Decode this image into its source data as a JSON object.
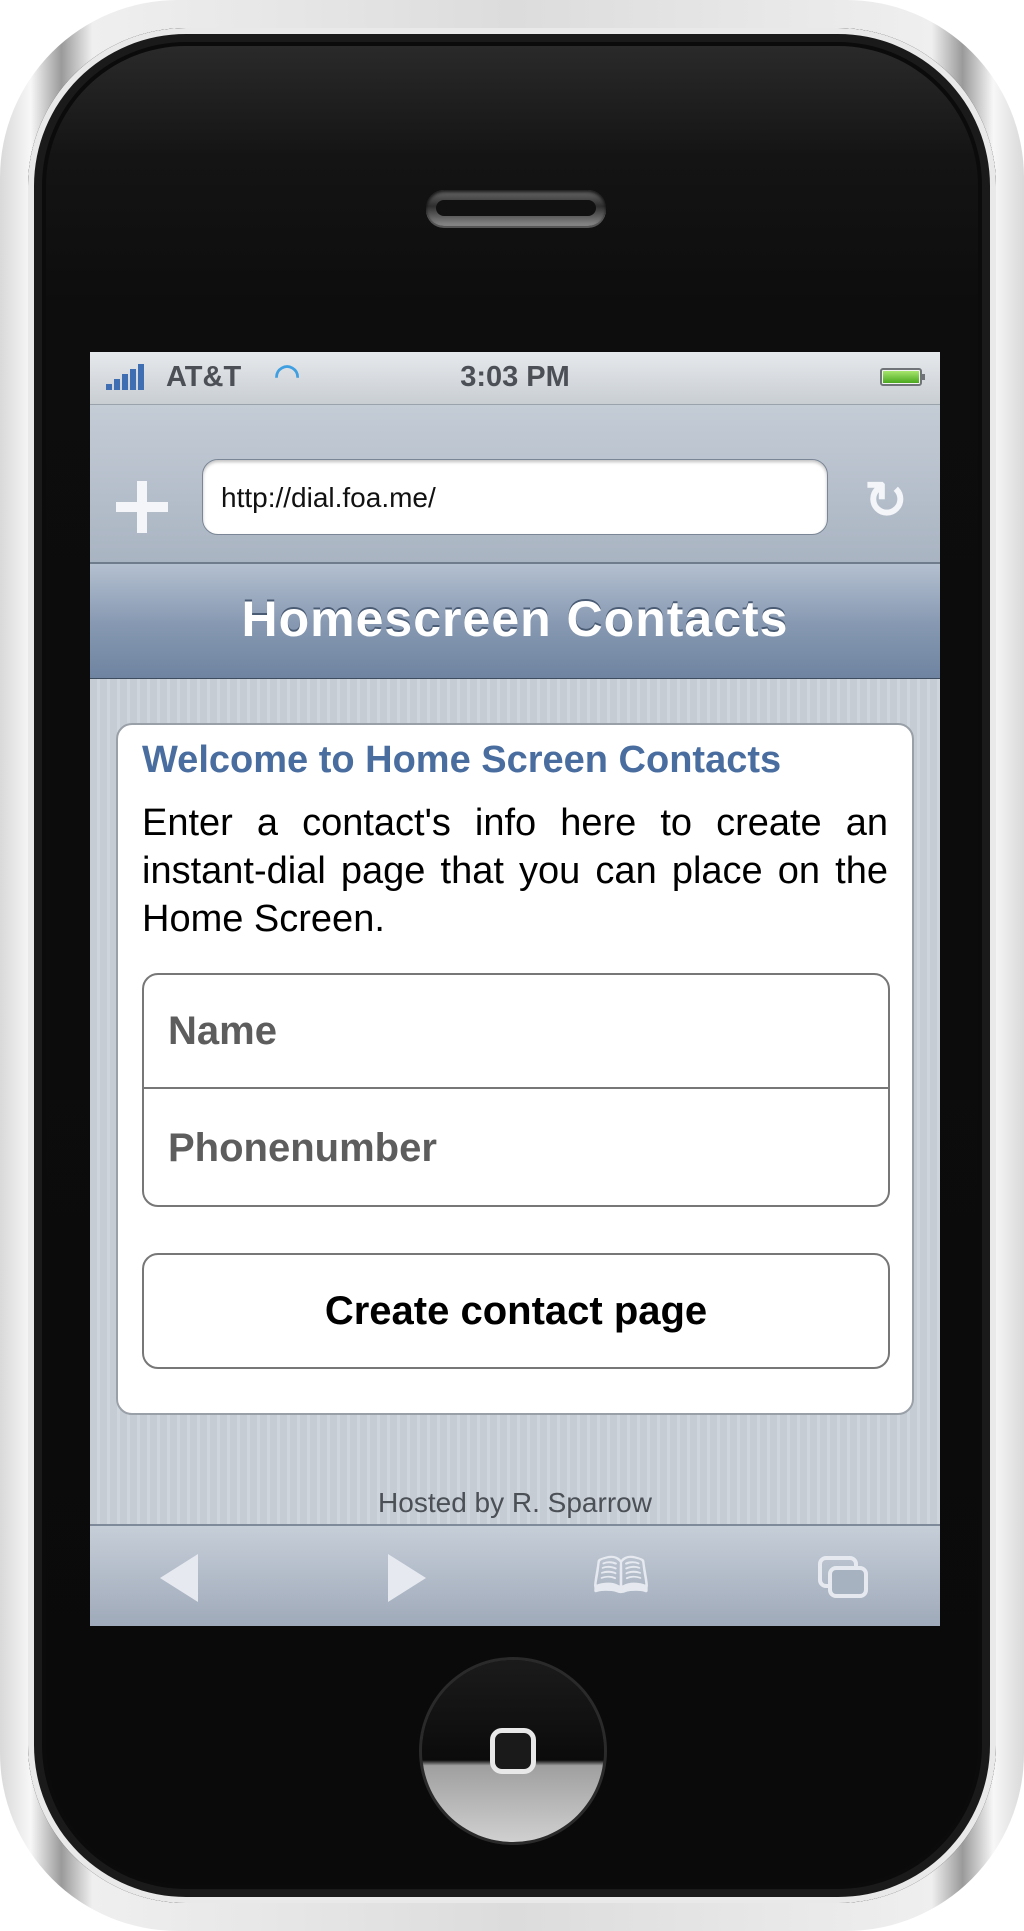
{
  "status_bar": {
    "carrier": "AT&T",
    "time": "3:03 PM"
  },
  "browser": {
    "url": "http://dial.foa.me/"
  },
  "page": {
    "title": "Homescreen Contacts",
    "welcome_heading": "Welcome to Home Screen Contacts",
    "intro_text": "Enter a contact's info here to create an instant-dial page that you can place on the Home Screen.",
    "form": {
      "name_placeholder": "Name",
      "phone_placeholder": "Phonenumber",
      "submit_label": "Create contact page"
    },
    "footer": "Hosted by R. Sparrow"
  },
  "icons": [
    "signal-icon",
    "wifi-icon",
    "battery-icon",
    "plus-icon",
    "reload-icon",
    "back-icon",
    "forward-icon",
    "bookmarks-icon",
    "pages-icon"
  ],
  "colors": {
    "heading_blue": "#4a6da0",
    "title_bar": "#8799b2",
    "wifi": "#3f9fe0",
    "battery": "#4aa81e"
  }
}
